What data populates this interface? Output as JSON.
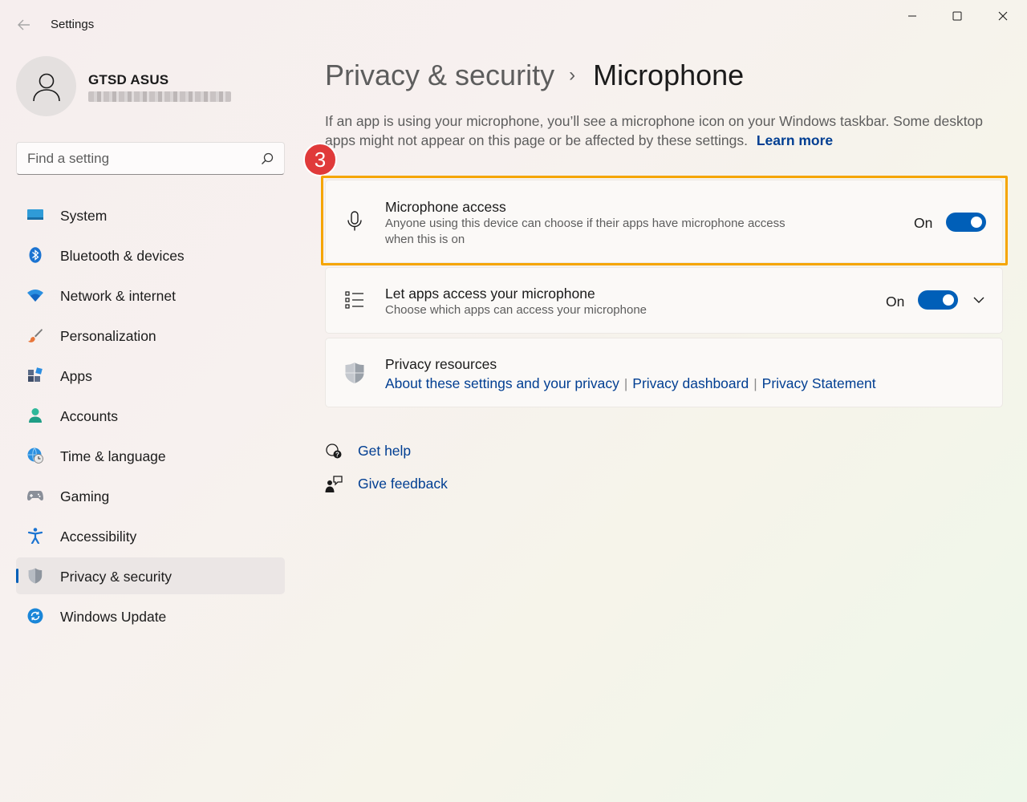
{
  "window": {
    "title": "Settings",
    "controls": [
      "minimize",
      "maximize",
      "close"
    ]
  },
  "profile": {
    "name": "GTSD ASUS",
    "email_redacted": true
  },
  "search": {
    "placeholder": "Find a setting",
    "value": ""
  },
  "sidebar": {
    "items": [
      {
        "label": "System",
        "icon": "system-icon"
      },
      {
        "label": "Bluetooth & devices",
        "icon": "bluetooth-icon"
      },
      {
        "label": "Network & internet",
        "icon": "wifi-icon"
      },
      {
        "label": "Personalization",
        "icon": "brush-icon"
      },
      {
        "label": "Apps",
        "icon": "apps-icon"
      },
      {
        "label": "Accounts",
        "icon": "person-icon"
      },
      {
        "label": "Time & language",
        "icon": "globe-clock-icon"
      },
      {
        "label": "Gaming",
        "icon": "gamepad-icon"
      },
      {
        "label": "Accessibility",
        "icon": "accessibility-icon"
      },
      {
        "label": "Privacy & security",
        "icon": "shield-icon",
        "selected": true
      },
      {
        "label": "Windows Update",
        "icon": "update-icon"
      }
    ],
    "selected_index": 9
  },
  "breadcrumb": {
    "parent": "Privacy & security",
    "separator": "›",
    "current": "Microphone"
  },
  "description": {
    "text": "If an app is using your microphone, you’ll see a microphone icon on your Windows taskbar. Some desktop apps might not appear on this page or be affected by these settings.",
    "link": "Learn more"
  },
  "step_badge": "3",
  "cards": {
    "mic_access": {
      "title": "Microphone access",
      "subtitle": "Anyone using this device can choose if their apps have microphone access when this is on",
      "toggle_text": "On",
      "toggle_on": true,
      "icon": "microphone-icon",
      "highlighted": true
    },
    "apps_access": {
      "title": "Let apps access your microphone",
      "subtitle": "Choose which apps can access your microphone",
      "toggle_text": "On",
      "toggle_on": true,
      "icon": "list-icon",
      "expandable": true
    },
    "resources": {
      "title": "Privacy resources",
      "icon": "shield-icon",
      "links": [
        "About these settings and your privacy",
        "Privacy dashboard",
        "Privacy Statement"
      ],
      "separator": "|"
    }
  },
  "help": {
    "get_help": "Get help",
    "give_feedback": "Give feedback"
  },
  "colors": {
    "accent": "#005fb8",
    "link": "#003e92",
    "highlight_border": "#f5a500",
    "badge": "#e03a3a"
  }
}
